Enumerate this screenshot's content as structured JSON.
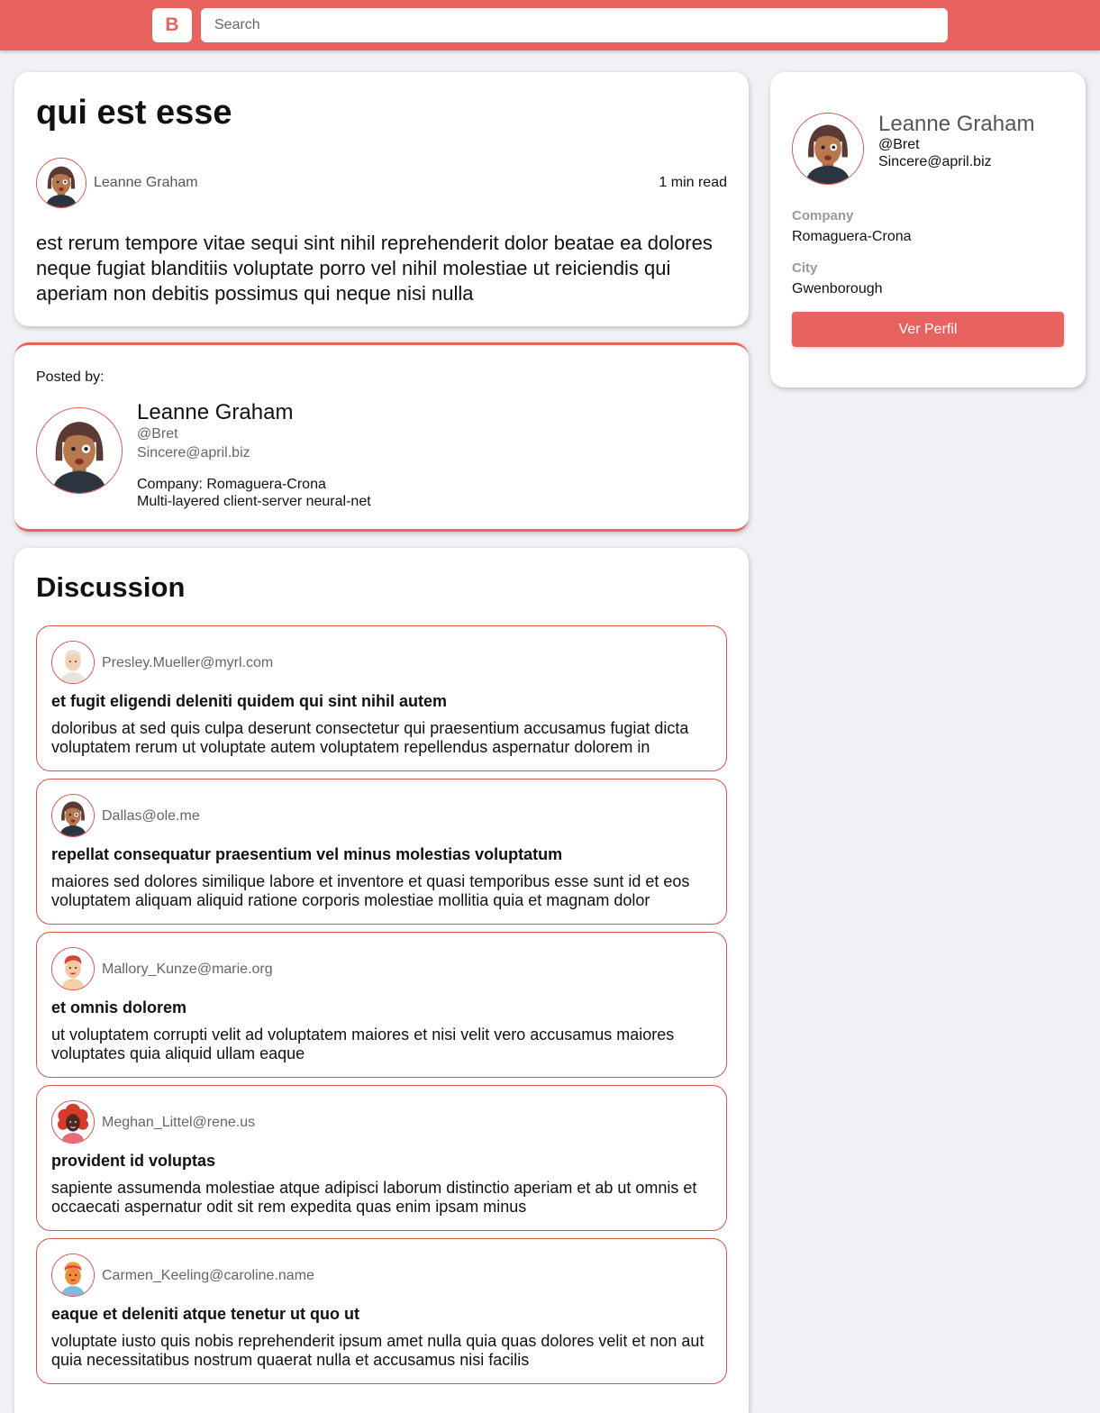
{
  "header": {
    "logo_letter": "B",
    "search_placeholder": "Search"
  },
  "post": {
    "title": "qui est esse",
    "author_name": "Leanne Graham",
    "read_time": "1 min read",
    "body": "est rerum tempore vitae sequi sint nihil reprehenderit dolor beatae ea dolores neque fugiat blanditiis voluptate porro vel nihil molestiae ut reiciendis qui aperiam non debitis possimus qui neque nisi nulla"
  },
  "posted_by": {
    "label": "Posted by:",
    "name": "Leanne Graham",
    "username": "@Bret",
    "email": "Sincere@april.biz",
    "company": "Company: Romaguera-Crona",
    "catch_phrase": "Multi-layered client-server neural-net"
  },
  "discussion": {
    "title": "Discussion",
    "comments": [
      {
        "email": "Presley.Mueller@myrl.com",
        "title": "et fugit eligendi deleniti quidem qui sint nihil autem",
        "body": "doloribus at sed quis culpa deserunt consectetur qui praesentium accusamus fugiat dicta voluptatem rerum ut voluptate autem voluptatem repellendus aspernatur dolorem in",
        "avatar_icon": "avatar-elderly-man-icon"
      },
      {
        "email": "Dallas@ole.me",
        "title": "repellat consequatur praesentium vel minus molestias voluptatum",
        "body": "maiores sed dolores similique labore et inventore et quasi temporibus esse sunt id et eos voluptatem aliquam aliquid ratione corporis molestiae mollitia quia et magnam dolor",
        "avatar_icon": "avatar-woman-bob-icon"
      },
      {
        "email": "Mallory_Kunze@marie.org",
        "title": "et omnis dolorem",
        "body": "ut voluptatem corrupti velit ad voluptatem maiores et nisi velit vero accusamus maiores voluptates quia aliquid ullam eaque",
        "avatar_icon": "avatar-redhead-man-icon"
      },
      {
        "email": "Meghan_Littel@rene.us",
        "title": "provident id voluptas",
        "body": "sapiente assumenda molestiae atque adipisci laborum distinctio aperiam et ab ut omnis et occaecati aspernatur odit sit rem expedita quas enim ipsam minus",
        "avatar_icon": "avatar-curly-hair-person-icon"
      },
      {
        "email": "Carmen_Keeling@caroline.name",
        "title": "eaque et deleniti atque tenetur ut quo ut",
        "body": "voluptate iusto quis nobis reprehenderit ipsum amet nulla quia quas dolores velit et non aut quia necessitatibus nostrum quaerat nulla et accusamus nisi facilis",
        "avatar_icon": "avatar-woman-headband-icon"
      }
    ]
  },
  "profile": {
    "name": "Leanne Graham",
    "username": "@Bret",
    "email": "Sincere@april.biz",
    "company_label": "Company",
    "company": "Romaguera-Crona",
    "city_label": "City",
    "city": "Gwenborough",
    "button_label": "Ver Perfil"
  },
  "colors": {
    "accent": "#e86360",
    "border": "#d9534f",
    "background": "#f0f1f4"
  }
}
